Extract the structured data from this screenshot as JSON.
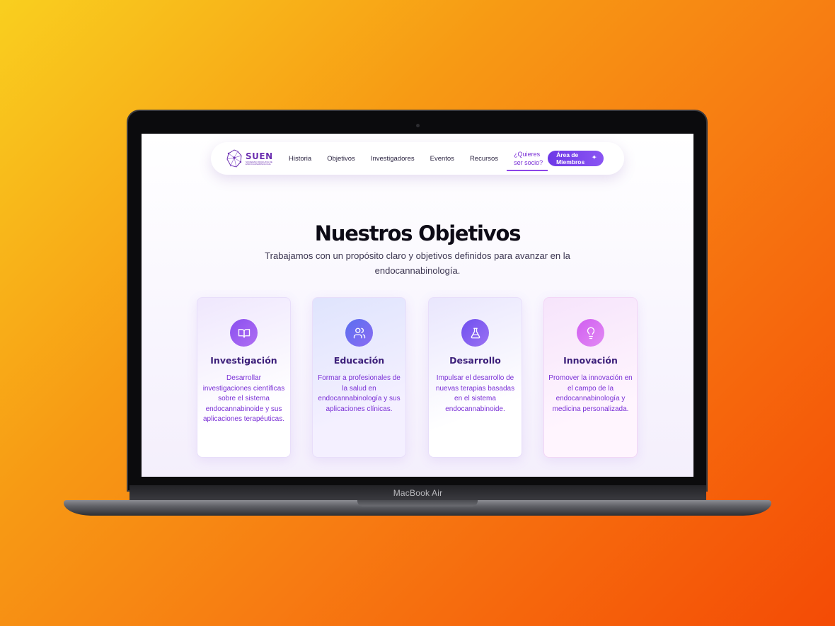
{
  "device": {
    "label": "MacBook Air"
  },
  "nav": {
    "logo": {
      "name": "SUEN",
      "subtitle": "SOCIEDAD URUGUAYA DE ENDOCANNABINOLOGÍA"
    },
    "links": [
      "Historia",
      "Objetivos",
      "Investigadores",
      "Eventos",
      "Recursos"
    ],
    "cta": "¿Quieres ser socio?",
    "members_button": "Área de Miembros"
  },
  "hero": {
    "title": "Nuestros Objetivos",
    "subtitle": "Trabajamos con un propósito claro y objetivos definidos para avanzar en la endocannabinología."
  },
  "cards": [
    {
      "icon": "book-icon",
      "title": "Investigación",
      "text": "Desarrollar investigaciones científicas sobre el sistema endocannabinoide y sus aplicaciones terapéuticas."
    },
    {
      "icon": "users-icon",
      "title": "Educación",
      "text": "Formar a profesionales de la salud en endocannabinología y sus aplicaciones clínicas."
    },
    {
      "icon": "flask-icon",
      "title": "Desarrollo",
      "text": "Impulsar el desarrollo de nuevas terapias basadas en el sistema endocannabinoide."
    },
    {
      "icon": "lightbulb-icon",
      "title": "Innovación",
      "text": "Promover la innovación en el campo de la endocannabinología y medicina personalizada."
    }
  ],
  "colors": {
    "accent": "#7a2fd6",
    "background_start": "#f9cf1f",
    "background_end": "#f44b05"
  }
}
